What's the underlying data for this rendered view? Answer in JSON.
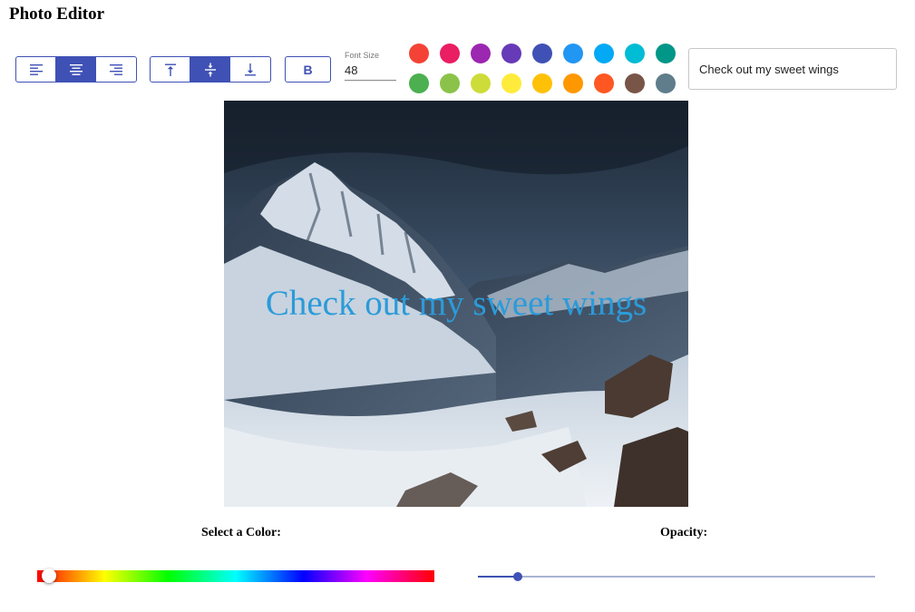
{
  "app": {
    "title": "Photo Editor"
  },
  "toolbar": {
    "align_horizontal": [
      {
        "icon": "align-left-icon",
        "active": false
      },
      {
        "icon": "align-center-icon",
        "active": true
      },
      {
        "icon": "align-right-icon",
        "active": false
      }
    ],
    "align_vertical": [
      {
        "icon": "align-top-icon",
        "active": false
      },
      {
        "icon": "align-middle-icon",
        "active": true
      },
      {
        "icon": "align-bottom-icon",
        "active": false
      }
    ],
    "bold_label": "B",
    "font_size": {
      "label": "Font Size",
      "value": "48"
    },
    "swatches": [
      "#f44336",
      "#e91e63",
      "#9c27b0",
      "#673ab7",
      "#3f51b5",
      "#2196f3",
      "#03a9f4",
      "#00bcd4",
      "#009688",
      "#4caf50",
      "#8bc34a",
      "#cddc39",
      "#ffeb3b",
      "#ffc107",
      "#ff9800",
      "#ff5722",
      "#795548",
      "#607d8b"
    ],
    "caption_input": "Check out my sweet wings"
  },
  "canvas": {
    "overlay_text": "Check out my sweet wings",
    "text_color": "#2b9bd9"
  },
  "controls": {
    "color_label": "Select a Color:",
    "opacity_label": "Opacity:",
    "hue_position": 0.03,
    "opacity_value": 0.1
  },
  "colors": {
    "accent": "#3f51b5"
  }
}
